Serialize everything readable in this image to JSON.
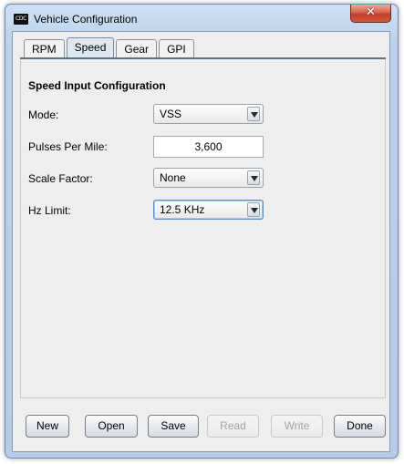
{
  "window": {
    "title": "Vehicle Configuration",
    "app_icon_text": "CDC",
    "close_glyph": "✕"
  },
  "tabs": [
    {
      "label": "RPM",
      "active": false
    },
    {
      "label": "Speed",
      "active": true
    },
    {
      "label": "Gear",
      "active": false
    },
    {
      "label": "GPI",
      "active": false
    }
  ],
  "section": {
    "title": "Speed Input Configuration",
    "mode": {
      "label": "Mode:",
      "value": "VSS"
    },
    "pulses_per_mile": {
      "label": "Pulses Per Mile:",
      "value": "3,600"
    },
    "scale_factor": {
      "label": "Scale Factor:",
      "value": "None"
    },
    "hz_limit": {
      "label": "Hz Limit:",
      "value": "12.5 KHz"
    }
  },
  "buttons": {
    "new": "New",
    "open": "Open",
    "save": "Save",
    "read": "Read",
    "write": "Write",
    "done": "Done"
  },
  "colors": {
    "title_bar": "#bcd2ec",
    "close_button": "#c2402a",
    "client_background": "#eeeeee",
    "disabled_text": "#a3a3a3"
  }
}
